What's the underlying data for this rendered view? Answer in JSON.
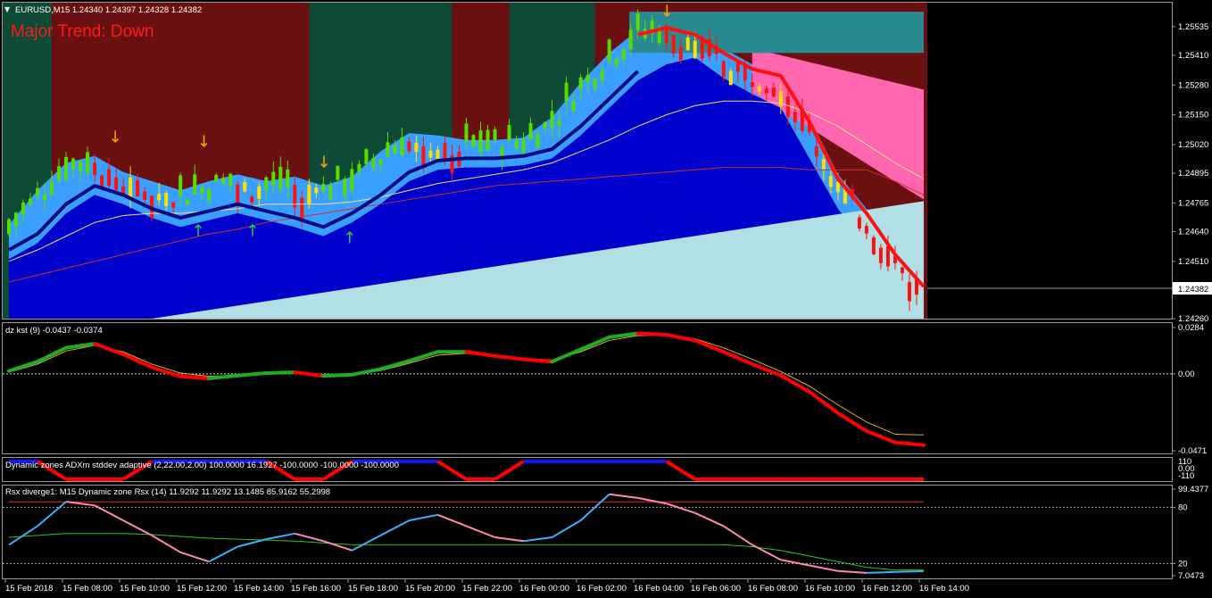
{
  "colors": {
    "bear_bg": "#6b1010",
    "bull_bg": "#0e4a35",
    "sky": "#3aa0ff",
    "deep_blue": "#0000cc",
    "light_cyan": "#b0dfe6",
    "pink": "#ff66b0",
    "teal": "#2a8a92",
    "bull_candle": "#55dd00",
    "bear_candle": "#ff1010",
    "yellow_candle": "#ffe000",
    "arrow_down": "#ffa500",
    "arrow_up": "#22cc44",
    "kst_up": "#22aa22",
    "kst_down": "#ff0000",
    "adx_blue": "#1515ff",
    "rsx_blue": "#3ab0ff",
    "rsx_pink": "#ff88bb"
  },
  "main_panel": {
    "header": "EURUSD,M15  1.24340 1.24397 1.24328 1.24382",
    "trend_label": "Major Trend: Down",
    "price_ticks": [
      "1.25535",
      "1.25410",
      "1.25280",
      "1.25150",
      "1.25020",
      "1.24895",
      "1.24765",
      "1.24640",
      "1.24510",
      "1.24260"
    ],
    "current_price": "1.24382"
  },
  "kst_panel": {
    "header": "dz kst (9) -0.0437 -0.0374",
    "ticks": [
      "0.0284",
      "0.00",
      "-0.0471"
    ]
  },
  "adx_panel": {
    "header": "Dynamic zones ADXm stddev adaptive (2,22.00,2.00) 100.0000 16.1927 -100.0000 -100.0000 -100.0000",
    "ticks": [
      "110",
      "0.00",
      "-110"
    ]
  },
  "rsx_panel": {
    "header": "Rsx diverge1: M15  Dynamic zone Rsx (14) 11.9292 11.9292 13.1485 85.9162 55.2998",
    "ticks": [
      "99.4377",
      "80",
      "20",
      "7.0473"
    ]
  },
  "time_axis": [
    "15 Feb 2018",
    "15 Feb 08:00",
    "15 Feb 10:00",
    "15 Feb 12:00",
    "15 Feb 14:00",
    "15 Feb 16:00",
    "15 Feb 18:00",
    "15 Feb 20:00",
    "15 Feb 22:00",
    "16 Feb 00:00",
    "16 Feb 02:00",
    "16 Feb 04:00",
    "16 Feb 06:00",
    "16 Feb 08:00",
    "16 Feb 10:00",
    "16 Feb 12:00",
    "16 Feb 14:00"
  ],
  "chart_data": [
    {
      "type": "candlestick",
      "title": "EURUSD,M15",
      "ylim": [
        1.2426,
        1.2562
      ],
      "x": [
        "15 Feb 06:00",
        "15 Feb 07:00",
        "15 Feb 08:00",
        "15 Feb 09:00",
        "15 Feb 10:00",
        "15 Feb 11:00",
        "15 Feb 12:00",
        "15 Feb 13:00",
        "15 Feb 14:00",
        "15 Feb 15:00",
        "15 Feb 16:00",
        "15 Feb 17:00",
        "15 Feb 18:00",
        "15 Feb 19:00",
        "15 Feb 20:00",
        "15 Feb 21:00",
        "15 Feb 22:00",
        "15 Feb 23:00",
        "16 Feb 00:00",
        "16 Feb 01:00",
        "16 Feb 02:00",
        "16 Feb 03:00",
        "16 Feb 04:00",
        "16 Feb 05:00",
        "16 Feb 06:00",
        "16 Feb 07:00",
        "16 Feb 08:00",
        "16 Feb 09:00",
        "16 Feb 10:00",
        "16 Feb 11:00",
        "16 Feb 12:00",
        "16 Feb 13:00",
        "16 Feb 14:00"
      ],
      "series": [
        {
          "values": [
            1.2463,
            1.2478,
            1.249,
            1.2493,
            1.2486,
            1.2482,
            1.2478,
            1.2482,
            1.2485,
            1.2482,
            1.2484,
            1.248,
            1.2484,
            1.2495,
            1.2503,
            1.2502,
            1.25,
            1.25,
            1.2501,
            1.251,
            1.2525,
            1.2538,
            1.2548,
            1.2551,
            1.2548,
            1.254,
            1.2533,
            1.253,
            1.251,
            1.2485,
            1.247,
            1.2452,
            1.2438
          ]
        },
        {
          "values": [
            1.2456,
            1.2463,
            1.2476,
            1.2484,
            1.248,
            1.2474,
            1.247,
            1.2473,
            1.2476,
            1.2473,
            1.247,
            1.2466,
            1.2472,
            1.248,
            1.249,
            1.2495,
            1.2496,
            1.2496,
            1.2497,
            1.25,
            1.251,
            1.2522,
            1.2534,
            1.2541,
            1.2544,
            1.2535,
            1.2528,
            1.2522,
            1.25,
            1.2478,
            1.2462,
            1.2446,
            1.2436
          ]
        },
        {
          "values": [
            1.2451,
            1.2456,
            1.2462,
            1.2468,
            1.2471,
            1.2472,
            1.2472,
            1.2473,
            1.2474,
            1.2476,
            1.2476,
            1.2476,
            1.2477,
            1.2479,
            1.2482,
            1.2485,
            1.2487,
            1.2489,
            1.2491,
            1.2494,
            1.2499,
            1.2504,
            1.251,
            1.2515,
            1.2519,
            1.2521,
            1.2521,
            1.252,
            1.2516,
            1.251,
            1.2502,
            1.2494,
            1.2487
          ]
        },
        {
          "values": [
            1.2428,
            1.2431,
            1.2434,
            1.2437,
            1.244,
            1.2443,
            1.2446,
            1.2449,
            1.2451,
            1.2454,
            1.2456,
            1.2458,
            1.246,
            1.2462,
            1.2464,
            1.2466,
            1.2468,
            1.247,
            1.2471,
            1.2472,
            1.2473,
            1.2474,
            1.2475,
            1.2476,
            1.2477,
            1.2478,
            1.2478,
            1.2478,
            1.2477,
            1.2477,
            1.2477,
            1.2472,
            1.2466
          ]
        }
      ]
    },
    {
      "type": "line",
      "title": "dz kst (9)",
      "ylim": [
        -0.0471,
        0.0284
      ],
      "series": [
        {
          "values": [
            0.0018,
            0.0075,
            0.016,
            0.0185,
            0.012,
            0.004,
            -0.0015,
            -0.0028,
            -0.001,
            0.0005,
            0.001,
            -0.0012,
            -0.0005,
            0.003,
            0.008,
            0.0135,
            0.0135,
            0.011,
            0.009,
            0.0075,
            0.015,
            0.0225,
            0.0248,
            0.024,
            0.0205,
            0.0135,
            0.006,
            -0.001,
            -0.011,
            -0.024,
            -0.035,
            -0.042,
            -0.0437
          ]
        },
        {
          "values": [
            0.001,
            0.006,
            0.014,
            0.0175,
            0.0135,
            0.006,
            0.0005,
            -0.0015,
            -0.001,
            0.0,
            0.0008,
            -0.0005,
            -0.0005,
            0.002,
            0.0065,
            0.0115,
            0.0125,
            0.011,
            0.0095,
            0.0085,
            0.0135,
            0.0205,
            0.0235,
            0.0238,
            0.0215,
            0.016,
            0.009,
            0.0015,
            -0.0075,
            -0.019,
            -0.0295,
            -0.037,
            -0.0374
          ]
        }
      ]
    },
    {
      "type": "line",
      "title": "Dynamic zones ADXm stddev adaptive (2,22.00,2.00)",
      "ylim": [
        -110,
        110
      ],
      "series": [
        {
          "values": [
            100,
            100,
            -100,
            -100,
            -100,
            100,
            100,
            100,
            100,
            100,
            -100,
            -100,
            100,
            100,
            100,
            100,
            -100,
            -100,
            100,
            100,
            100,
            100,
            100,
            100,
            -100,
            -100,
            -100,
            -100,
            -100,
            -100,
            -100,
            -100,
            -100
          ]
        }
      ]
    },
    {
      "type": "line",
      "title": "Dynamic zone Rsx (14)",
      "ylim": [
        7.0473,
        99.4377
      ],
      "series": [
        {
          "values": [
            40,
            60,
            86,
            82,
            66,
            50,
            32,
            22,
            38,
            46,
            52,
            44,
            34,
            50,
            66,
            72,
            60,
            48,
            44,
            48,
            66,
            94,
            90,
            84,
            74,
            60,
            40,
            24,
            18,
            12,
            10,
            11,
            11.9292
          ]
        },
        {
          "values": [
            85.9162,
            85.9162,
            85.9162,
            85.9162,
            85.9162,
            85.9162,
            85.9162,
            85.9162,
            85.9162,
            85.9162,
            85.9162,
            85.9162,
            85.9162,
            85.9162,
            85.9162,
            85.9162,
            85.9162,
            85.9162,
            85.9162,
            85.9162,
            85.9162,
            85.9162,
            85.9162,
            85.9162,
            85.9162,
            85.9162,
            85.9162,
            85.9162,
            85.9162,
            85.9162,
            85.9162,
            85.9162,
            85.9162
          ]
        },
        {
          "values": [
            48,
            50,
            52,
            52,
            52,
            51,
            49,
            47,
            46,
            45,
            44,
            42,
            40,
            40,
            40,
            40,
            40,
            40,
            40,
            40,
            40,
            40,
            40,
            40,
            40,
            40,
            38,
            34,
            28,
            22,
            16,
            13,
            13.1485
          ]
        }
      ]
    }
  ]
}
